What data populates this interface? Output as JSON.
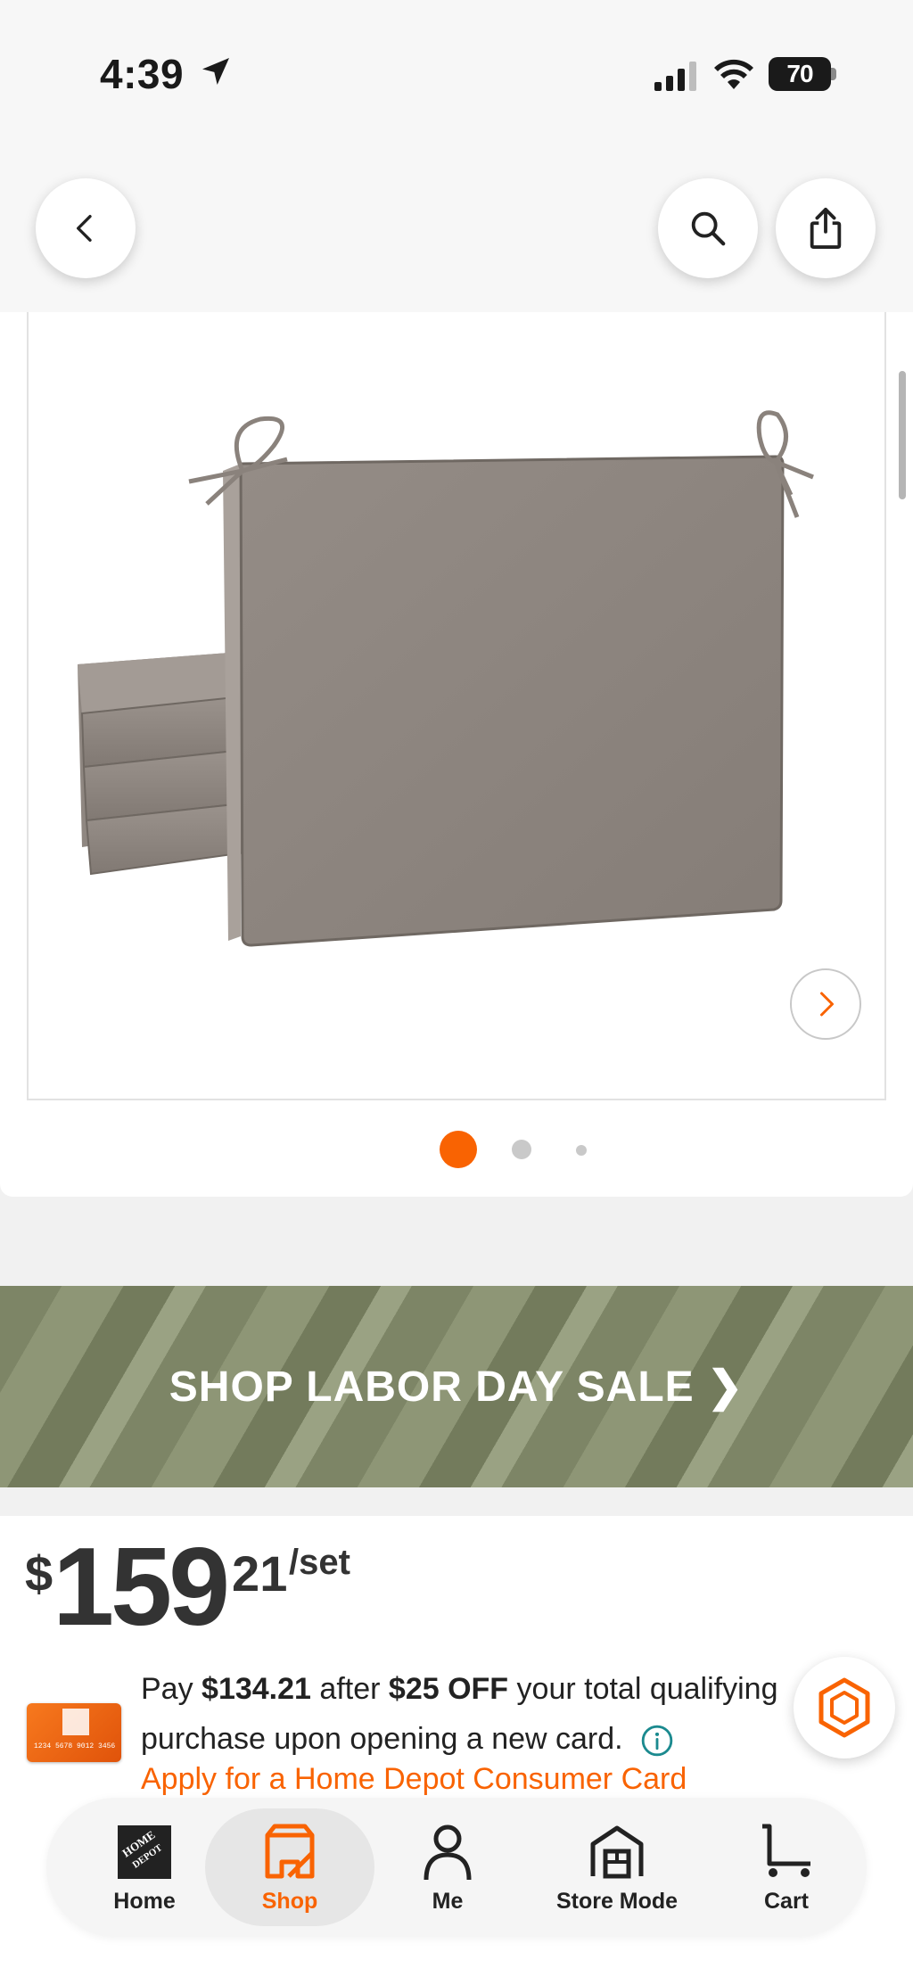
{
  "status_bar": {
    "time": "4:39",
    "battery": "70",
    "icons": [
      "location-arrow-icon",
      "cellular-signal-icon",
      "wifi-icon",
      "battery-icon"
    ]
  },
  "top_nav": {
    "back_icon": "chevron-left-icon",
    "search_icon": "search-icon",
    "share_icon": "share-icon"
  },
  "gallery": {
    "image_alt": "Stack of taupe outdoor chair cushions with ties",
    "next_icon": "chevron-right-icon",
    "current_index": 1,
    "total_images": 3
  },
  "banner": {
    "text": "SHOP LABOR DAY SALE ❯"
  },
  "price": {
    "symbol": "$",
    "dollars": "159",
    "cents": "21",
    "unit": "/set"
  },
  "promo": {
    "pay_prefix": "Pay",
    "pay_amount": "$134.21",
    "after": "after",
    "discount": "$25 OFF",
    "rest_line1": "your total qualifying",
    "line2": "purchase upon opening a new card.",
    "apply_link": "Apply for a Home Depot Consumer Card",
    "card_number": "1234 5678 9012 3456"
  },
  "tabs": [
    {
      "label": "Home",
      "icon": "home-depot-logo-icon",
      "active": false
    },
    {
      "label": "Shop",
      "icon": "shop-icon",
      "active": true
    },
    {
      "label": "Me",
      "icon": "person-icon",
      "active": false
    },
    {
      "label": "Store Mode",
      "icon": "store-icon",
      "active": false
    },
    {
      "label": "Cart",
      "icon": "cart-icon",
      "active": false
    }
  ],
  "colors": {
    "brand_orange": "#f96302",
    "banner_green": "#7d8566",
    "price_text": "#333333"
  }
}
